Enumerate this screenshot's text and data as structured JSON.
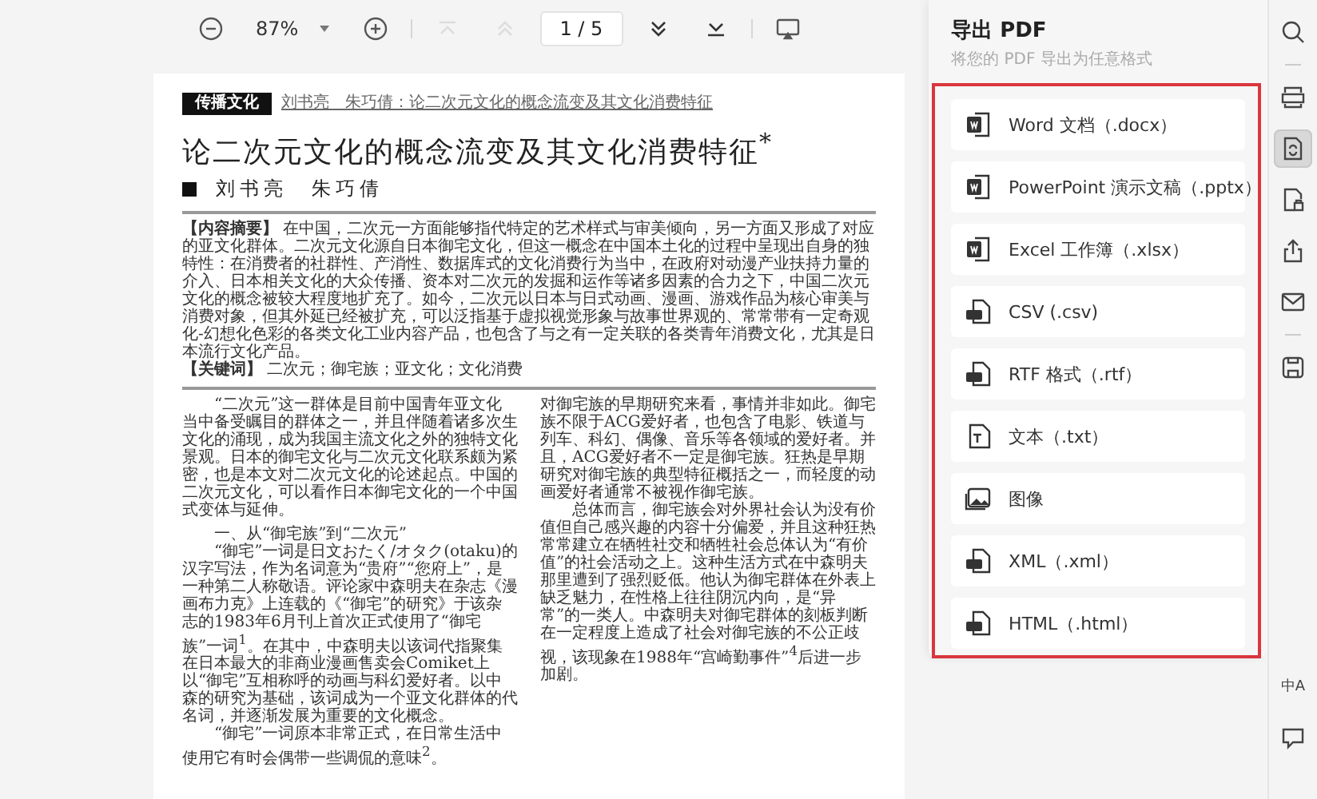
{
  "toolbar": {
    "zoom": "87%",
    "page_field": "1 / 5",
    "nav": [
      {
        "kind": "first",
        "disabled": true
      },
      {
        "kind": "prev",
        "disabled": true
      },
      {
        "kind": "next",
        "disabled": false
      },
      {
        "kind": "last",
        "disabled": false
      }
    ]
  },
  "document": {
    "section_tag": "传播文化",
    "running_header": "刘书亮　朱巧倩：论二次元文化的概念流变及其文化消费特征",
    "title": "论二次元文化的概念流变及其文化消费特征$^{*}$",
    "authors": "刘书亮　朱巧倩",
    "abstract": "**【内容摘要】** 在中国，二次元一方面能够指代特定的艺术样式与审美倾向，另一方面又形成了对应的亚文化群体。二次元文化源自日本御宅文化，但这一概念在中国本土化的过程中呈现出自身的独特性：在消费者的社群性、产消性、数据库式的文化消费行为当中，在政府对动漫产业扶持力量的介入、日本相关文化的大众传播、资本对二次元的发掘和运作等诸多因素的合力之下，中国二次元文化的概念被较大程度地扩充了。如今，二次元以日本与日式动画、漫画、游戏作品为核心审美与消费对象，但其外延已经被扩充，可以泛指基于虚拟视觉形象与故事世界观的、常常带有一定奇观化-幻想化色彩的各类文化工业内容产品，也包含了与之有一定关联的各类青年消费文化，尤其是日本流行文化产品。",
    "keywords": "**【关键词】** 二次元；御宅族；亚文化；文化消费",
    "columns": [
      {
        "paragraphs": [
          {
            "kind": "body",
            "text": "“二次元”这一群体是目前中国青年亚文化当中备受瞩目的群体之一，并且伴随着诸多次生文化的涌现，成为我国主流文化之外的独特文化景观。日本的御宅文化与二次元文化联系颇为紧密，也是本文对二次元文化的论述起点。中国的二次元文化，可以看作日本御宅文化的一个中国式变体与延伸。"
          },
          {
            "kind": "heading",
            "text": "一、从“御宅族”到“二次元”"
          },
          {
            "kind": "body",
            "text": "“御宅”一词是日文おたく/オタク(otaku)的汉字写法，作为名词意为“贵府”“您府上”，是一种第二人称敬语。评论家中森明夫在杂志《漫画布力克》上连载的《“御宅”的研究》于该杂志的1983年6月刊上首次正式使用了“御宅族”一词$^{1}$。在其中，中森明夫以该词代指聚集在日本最大的非商业漫画售卖会Comiket上以“御宅”互相称呼的动画与科幻爱好者。以中森的研究为基础，该词成为一个亚文化群体的代名词，并逐渐发展为重要的文化概念。"
          },
          {
            "kind": "body",
            "text": "“御宅”一词原本非常正式，在日常生活中使用它有时会偶带一些调侃的意味$^{2}$。"
          }
        ]
      },
      {
        "paragraphs": [
          {
            "kind": "body_continued",
            "text": "对御宅族的早期研究来看，事情并非如此。御宅族不限于ACG爱好者，也包含了电影、铁道与列车、科幻、偶像、音乐等各领域的爱好者。并且，ACG爱好者不一定是御宅族。狂热是早期研究对御宅族的典型特征概括之一，而轻度的动画爱好者通常不被视作御宅族。"
          },
          {
            "kind": "body",
            "text": "总体而言，御宅族会对外界社会认为没有价值但自己感兴趣的内容十分偏爱，并且这种狂热常常建立在牺牲社交和牺牲社会总体认为“有价值”的社会活动之上。这种生活方式在中森明夫那里遭到了强烈贬低。他认为御宅群体在外表上缺乏魅力，在性格上往往阴沉内向，是“异常”的一类人。中森明夫对御宅群体的刻板判断在一定程度上造成了社会对御宅族的不公正歧视，该现象在1988年“宫崎勤事件”$^{4}$后进一步加剧。"
          }
        ]
      }
    ]
  },
  "export_panel": {
    "title": "导出 PDF",
    "subtitle": "将您的 PDF 导出为任意格式",
    "formats": [
      {
        "kind": "word",
        "label": "Word 文档（.docx）"
      },
      {
        "kind": "ppt",
        "label": "PowerPoint 演示文稿（.pptx）"
      },
      {
        "kind": "excel",
        "label": "Excel 工作簿（.xlsx）"
      },
      {
        "kind": "csv",
        "label": "CSV (.csv)"
      },
      {
        "kind": "rtf",
        "label": "RTF 格式（.rtf）"
      },
      {
        "kind": "txt",
        "label": "文本（.txt）"
      },
      {
        "kind": "image",
        "label": "图像"
      },
      {
        "kind": "xml",
        "label": "XML（.xml）"
      },
      {
        "kind": "html",
        "label": "HTML（.html）"
      }
    ]
  },
  "tool_strip": [
    {
      "kind": "search",
      "selected": false
    },
    {
      "kind": "divider"
    },
    {
      "kind": "ocr",
      "selected": false
    },
    {
      "kind": "convert",
      "selected": true
    },
    {
      "kind": "lock",
      "selected": false
    },
    {
      "kind": "share",
      "selected": false
    },
    {
      "kind": "mail",
      "selected": false
    },
    {
      "kind": "divider"
    },
    {
      "kind": "save",
      "selected": false
    },
    {
      "kind": "spacer"
    },
    {
      "kind": "translate",
      "selected": false,
      "glyph": "中A"
    },
    {
      "kind": "comment",
      "selected": false
    }
  ]
}
